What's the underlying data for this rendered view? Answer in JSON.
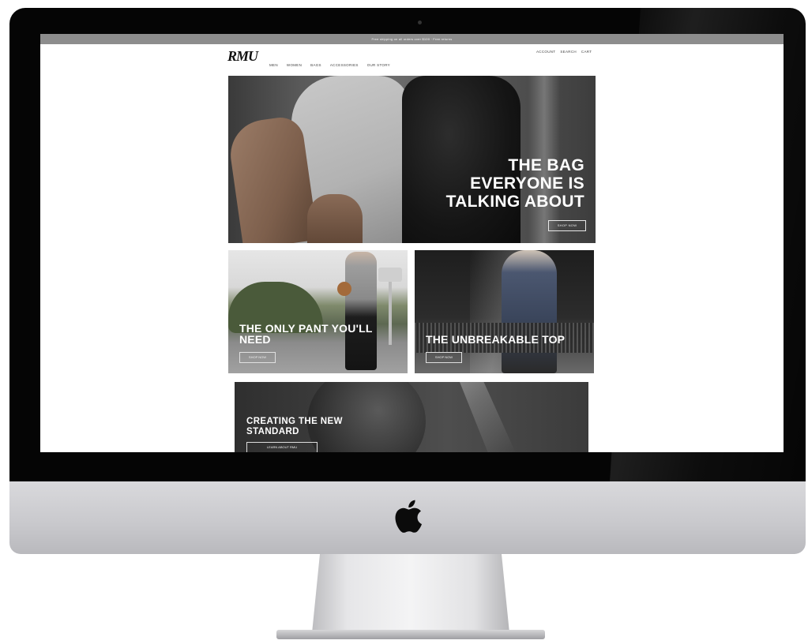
{
  "promo_bar": {
    "text": "Free shipping on all orders over $100 · Free returns"
  },
  "header": {
    "logo": "RMU",
    "nav_items": [
      "Men",
      "Women",
      "Bags",
      "Accessories",
      "Our Story"
    ],
    "utility_items": [
      "Account",
      "Search",
      "Cart"
    ]
  },
  "hero": {
    "title_lines": [
      "THE BAG",
      "EVERYONE IS",
      "TALKING ABOUT"
    ],
    "button_label": "SHOP NOW"
  },
  "tiles": [
    {
      "title_lines": [
        "THE ONLY PANT YOU'LL",
        "NEED"
      ],
      "button_label": "SHOP NOW"
    },
    {
      "title_lines": [
        "THE UNBREAKABLE TOP"
      ],
      "button_label": "SHOP NOW"
    }
  ],
  "banner": {
    "title_lines": [
      "CREATING THE NEW",
      "STANDARD"
    ],
    "button_label": "LEARN ABOUT RMU"
  },
  "colors": {
    "bezel": "#050505",
    "promo_bar": "#8d8d8d",
    "aluminum_chin": "#c8c8cc"
  }
}
